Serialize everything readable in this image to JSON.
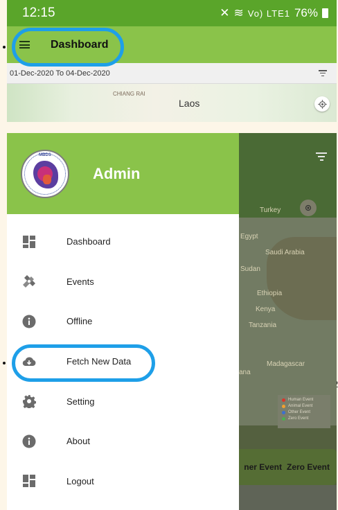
{
  "status_bar": {
    "time": "12:15",
    "signal_text": "Vo) LTE1",
    "battery": "76%"
  },
  "app_bar": {
    "title": "Dashboard"
  },
  "date_range": "01-Dec-2020 To 04-Dec-2020",
  "map_labels": {
    "small": "CHIANG RAI",
    "country": "Laos"
  },
  "drawer": {
    "user": "Admin",
    "logo_text": "MBDS",
    "items": [
      {
        "label": "Dashboard",
        "icon": "dashboard-icon"
      },
      {
        "label": "Events",
        "icon": "events-icon"
      },
      {
        "label": "Offline",
        "icon": "info-icon"
      },
      {
        "label": "Fetch New Data",
        "icon": "cloud-download-icon"
      },
      {
        "label": "Setting",
        "icon": "gear-icon"
      },
      {
        "label": "About",
        "icon": "info-icon"
      },
      {
        "label": "Logout",
        "icon": "dashboard-icon"
      }
    ]
  },
  "background_map": {
    "labels": [
      "Turkey",
      "Egypt",
      "Saudi Arabia",
      "Sudan",
      "Ethiopia",
      "Kenya",
      "Tanzania",
      "Madagascar",
      "ana"
    ],
    "legend": [
      "Human Event",
      "Animal Event",
      "Other Event",
      "Zero Event"
    ],
    "legend_colors": [
      "#d9352b",
      "#f0a030",
      "#3b6fd0",
      "#4caf50"
    ],
    "bottom_buttons": [
      "ner Event",
      "Zero Event"
    ]
  },
  "stray_mark": "2",
  "colors": {
    "status_green": "#5aa52a",
    "appbar_green": "#8ac34a",
    "highlight_blue": "#1e9fe8",
    "icon_gray": "#6b6b6b"
  }
}
